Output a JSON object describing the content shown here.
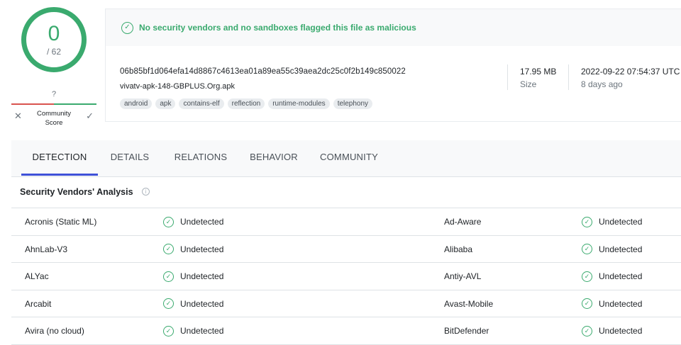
{
  "score": {
    "detections": "0",
    "total": "/ 62",
    "community_unknown": "?",
    "community_label": "Community Score",
    "ring_color": "#3aaa6e"
  },
  "status": {
    "text": "No security vendors and no sandboxes flagged this file as malicious",
    "color": "#3aaa6e"
  },
  "file": {
    "hash": "06b85bf1d064efa14d8867c4613ea01a89ea55c39aea2dc25c0f2b149c850022",
    "name": "vivatv-apk-148-GBPLUS.Org.apk",
    "tags": [
      "android",
      "apk",
      "contains-elf",
      "reflection",
      "runtime-modules",
      "telephony"
    ],
    "size_value": "17.95 MB",
    "size_label": "Size",
    "date_value": "2022-09-22 07:54:37 UTC",
    "date_label": "8 days ago"
  },
  "tabs": [
    {
      "label": "DETECTION",
      "active": true
    },
    {
      "label": "DETAILS",
      "active": false
    },
    {
      "label": "RELATIONS",
      "active": false
    },
    {
      "label": "BEHAVIOR",
      "active": false
    },
    {
      "label": "COMMUNITY",
      "active": false
    }
  ],
  "section": {
    "title": "Security Vendors' Analysis"
  },
  "vendors": [
    {
      "left": "Acronis (Static ML)",
      "left_result": "Undetected",
      "right": "Ad-Aware",
      "right_result": "Undetected"
    },
    {
      "left": "AhnLab-V3",
      "left_result": "Undetected",
      "right": "Alibaba",
      "right_result": "Undetected"
    },
    {
      "left": "ALYac",
      "left_result": "Undetected",
      "right": "Antiy-AVL",
      "right_result": "Undetected"
    },
    {
      "left": "Arcabit",
      "left_result": "Undetected",
      "right": "Avast-Mobile",
      "right_result": "Undetected"
    },
    {
      "left": "Avira (no cloud)",
      "left_result": "Undetected",
      "right": "BitDefender",
      "right_result": "Undetected"
    }
  ],
  "colors": {
    "accent": "#3f51d8",
    "clean": "#3aaa6e",
    "negative": "#d9534f"
  }
}
